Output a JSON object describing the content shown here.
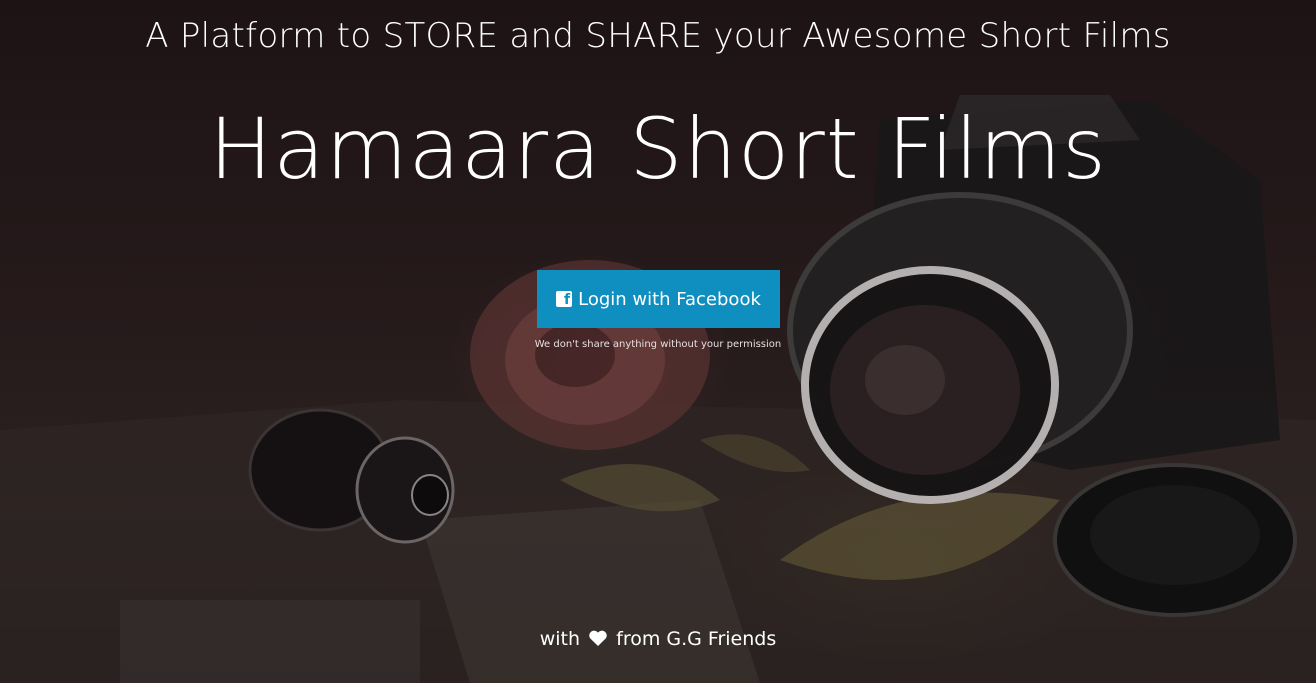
{
  "hero": {
    "tagline": "A Platform to STORE and SHARE your Awesome Short Films",
    "title": "Hamaara Short Films"
  },
  "login": {
    "button_label": "Login with Facebook",
    "icon": "facebook-icon",
    "disclaimer": "We don't share anything without your permission"
  },
  "footer": {
    "prefix": "with",
    "icon": "heart-icon",
    "suffix": "from G.G Friends"
  },
  "colors": {
    "button_bg": "#0f8fc0",
    "text": "#ffffff",
    "overlay": "#1e1416"
  }
}
